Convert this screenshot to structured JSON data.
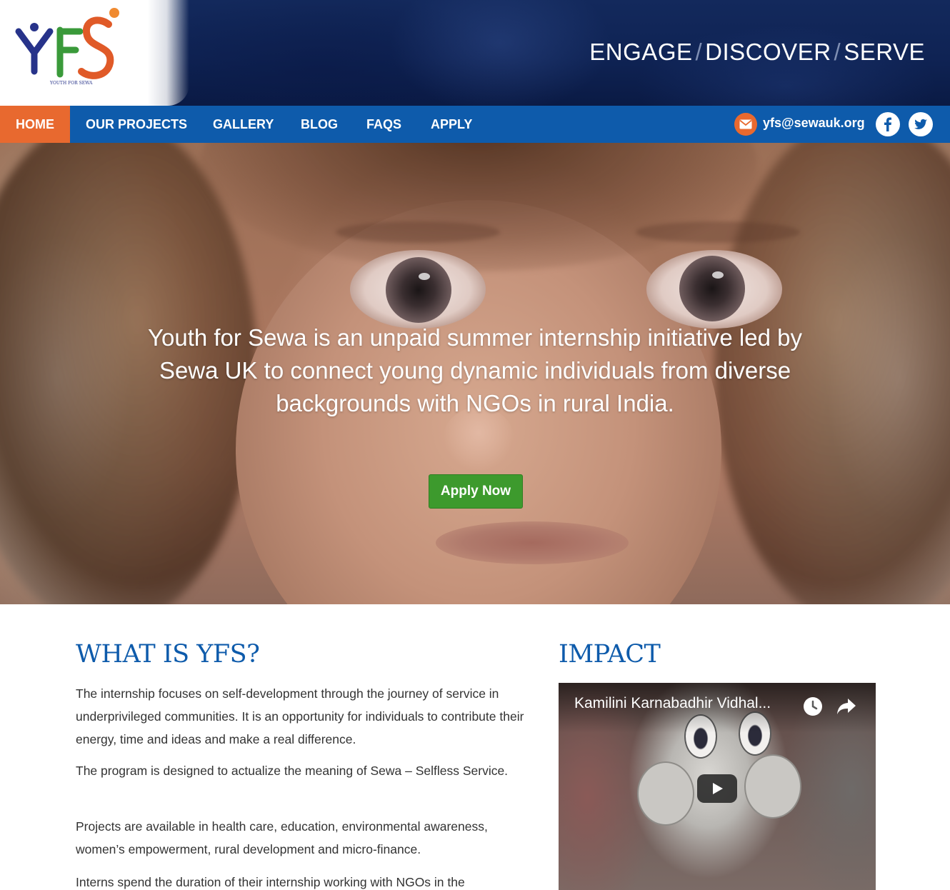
{
  "header": {
    "logo_text": "YFS",
    "logo_subtext": "YOUTH FOR SEWA",
    "tagline": [
      "ENGAGE",
      "DISCOVER",
      "SERVE"
    ],
    "tagline_separator": "/"
  },
  "nav": {
    "items": [
      "HOME",
      "OUR PROJECTS",
      "GALLERY",
      "BLOG",
      "FAQS",
      "APPLY"
    ],
    "active": "HOME",
    "email": "yfs@sewauk.org",
    "social": [
      "facebook-icon",
      "twitter-icon"
    ]
  },
  "hero": {
    "text": "Youth for Sewa is an unpaid summer internship initiative led by Sewa UK to connect young dynamic individuals from diverse backgrounds with NGOs in rural India.",
    "button": "Apply Now"
  },
  "what_is": {
    "title": "WHAT IS YFS?",
    "paragraphs": [
      "The internship focuses on self-development through the journey of service in underprivileged communities. It is an opportunity for individuals to contribute their energy, time and ideas and make a real difference.",
      "The program is designed to actualize the meaning of Sewa – Selfless Service.",
      "Projects are available in health care, education, environmental awareness, women’s empowerment, rural development and micro-finance.",
      "Interns spend the duration of their internship working with NGOs in the"
    ]
  },
  "impact": {
    "title": "IMPACT",
    "video_title": "Kamilini Karnabadhir Vidhal..."
  },
  "colors": {
    "brand_blue": "#0e5bab",
    "accent_orange": "#e8692f",
    "button_green": "#3d9a2d",
    "header_navy": "#13295c"
  }
}
